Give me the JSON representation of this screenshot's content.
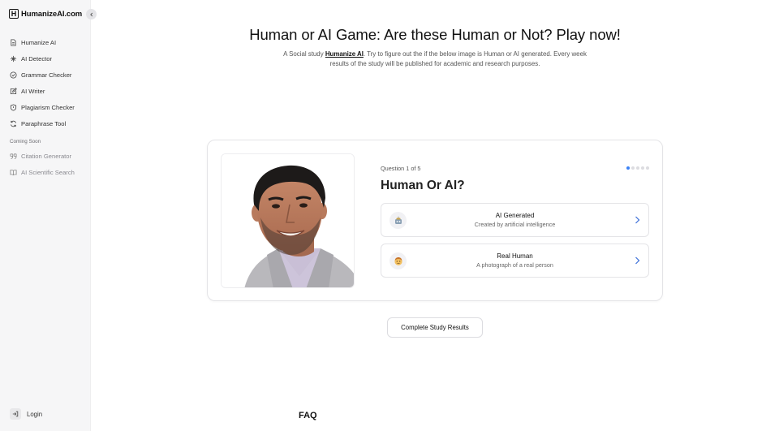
{
  "brand": {
    "box_letter": "H",
    "name": "HumanizeAI.com"
  },
  "sidebar": {
    "items": [
      {
        "label": "Humanize AI",
        "icon": "document-icon"
      },
      {
        "label": "AI Detector",
        "icon": "sparkle-icon"
      },
      {
        "label": "Grammar Checker",
        "icon": "check-circle-icon"
      },
      {
        "label": "AI Writer",
        "icon": "edit-icon"
      },
      {
        "label": "Plagiarism Checker",
        "icon": "shield-icon"
      },
      {
        "label": "Paraphrase Tool",
        "icon": "refresh-icon"
      }
    ],
    "coming_soon_label": "Coming Soon",
    "coming_soon_items": [
      {
        "label": "Citation Generator",
        "icon": "quote-icon"
      },
      {
        "label": "AI Scientific Search",
        "icon": "book-icon"
      }
    ],
    "login_label": "Login"
  },
  "page": {
    "title": "Human or AI Game: Are these Human or Not? Play now!",
    "subtitle_prefix": "A Social study ",
    "subtitle_link": "Humanize AI",
    "subtitle_suffix": ". Try to figure out the if the below image is Human or AI generated. Every week results of the study will be published for academic and research purposes."
  },
  "quiz": {
    "question_number": "Question 1 of 5",
    "current_question": 1,
    "total_questions": 5,
    "question": "Human Or AI?",
    "options": [
      {
        "title": "AI Generated",
        "description": "Created by artificial intelligence",
        "icon": "robot-icon"
      },
      {
        "title": "Real Human",
        "description": "A photograph of a real person",
        "icon": "person-face-icon"
      }
    ]
  },
  "results_button_label": "Complete Study Results",
  "faq_heading": "FAQ",
  "colors": {
    "accent": "#3b82f6",
    "sidebar_bg": "#f6f6f7",
    "border": "#e4e4e7"
  }
}
